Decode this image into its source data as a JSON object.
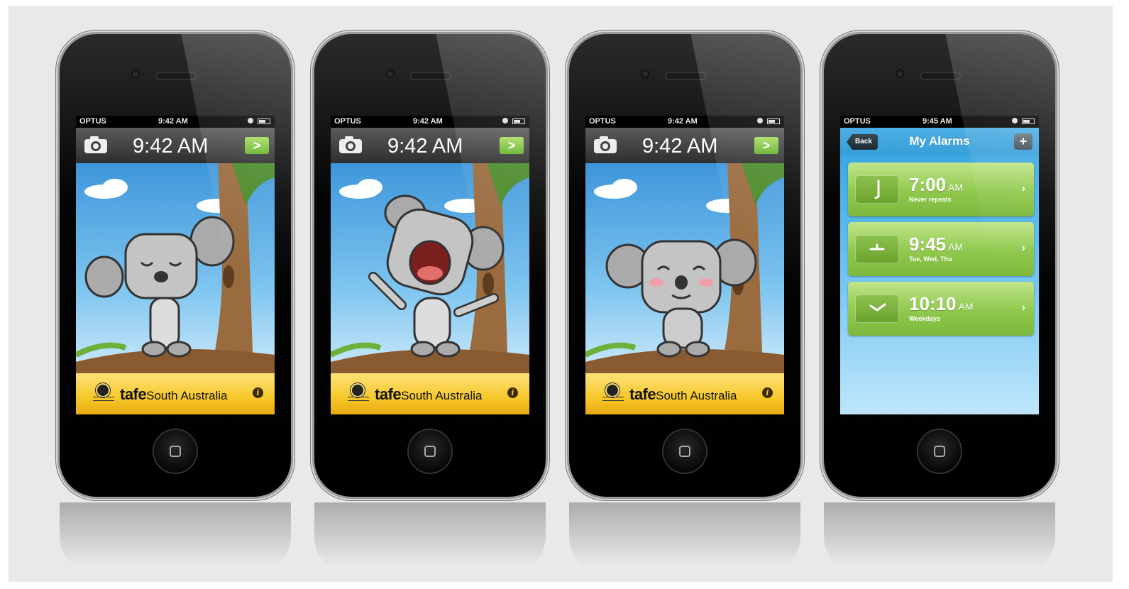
{
  "lock_screens": [
    {
      "status": {
        "carrier": "OPTUS",
        "time": "9:42 AM"
      },
      "clock": "9:42 AM",
      "unlock_label": ">",
      "koala_state": "sleeping",
      "footer": {
        "brand_bold": "tafe",
        "brand_rest": "South Australia",
        "info_label": "i"
      }
    },
    {
      "status": {
        "carrier": "OPTUS",
        "time": "9:42 AM"
      },
      "clock": "9:42 AM",
      "unlock_label": ">",
      "koala_state": "yawning",
      "footer": {
        "brand_bold": "tafe",
        "brand_rest": "South Australia",
        "info_label": "i"
      }
    },
    {
      "status": {
        "carrier": "OPTUS",
        "time": "9:42 AM"
      },
      "clock": "9:42 AM",
      "unlock_label": ">",
      "koala_state": "happy",
      "footer": {
        "brand_bold": "tafe",
        "brand_rest": "South Australia",
        "info_label": "i"
      }
    }
  ],
  "alarms_screen": {
    "status": {
      "carrier": "OPTUS",
      "time": "9:45 AM"
    },
    "back_label": "Back",
    "title": "My Alarms",
    "add_label": "+",
    "alarms": [
      {
        "time": "7:00",
        "ampm": "AM",
        "repeat": "Never repeats",
        "chevron": "›"
      },
      {
        "time": "9:45",
        "ampm": "AM",
        "repeat": "Tue, Wed, Thu",
        "chevron": "›"
      },
      {
        "time": "10:10",
        "ampm": "AM",
        "repeat": "Weekdays",
        "chevron": "›"
      }
    ]
  },
  "colors": {
    "background": "#e8e9ea",
    "accent_green": "#8fc84c",
    "footer_yellow": "#f7c82a",
    "sky_blue": "#3e96da"
  }
}
